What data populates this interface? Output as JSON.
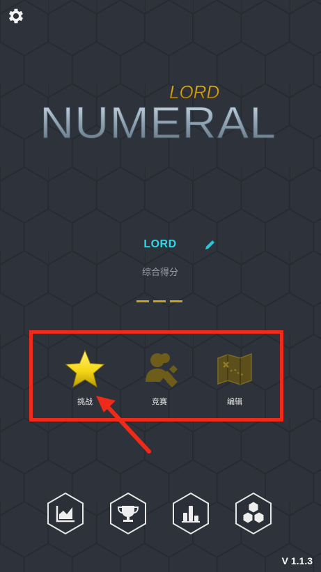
{
  "app": {
    "logo_small": "LORD",
    "logo_big": "NUMERAL",
    "version": "V 1.1.3"
  },
  "profile": {
    "username": "LORD",
    "score_label": "综合得分",
    "score_value": "— — —"
  },
  "modes": [
    {
      "label": "挑战",
      "icon": "star-icon"
    },
    {
      "label": "竞赛",
      "icon": "players-icon"
    },
    {
      "label": "编辑",
      "icon": "map-icon"
    }
  ],
  "bottom_nav": [
    {
      "icon": "stats-chart-icon"
    },
    {
      "icon": "trophy-icon"
    },
    {
      "icon": "leaderboard-icon"
    },
    {
      "icon": "cubes-icon"
    }
  ],
  "colors": {
    "background": "#2e333b",
    "accent_cyan": "#2fd8e6",
    "gold": "#c8a520",
    "highlight_red": "#f02a18"
  }
}
